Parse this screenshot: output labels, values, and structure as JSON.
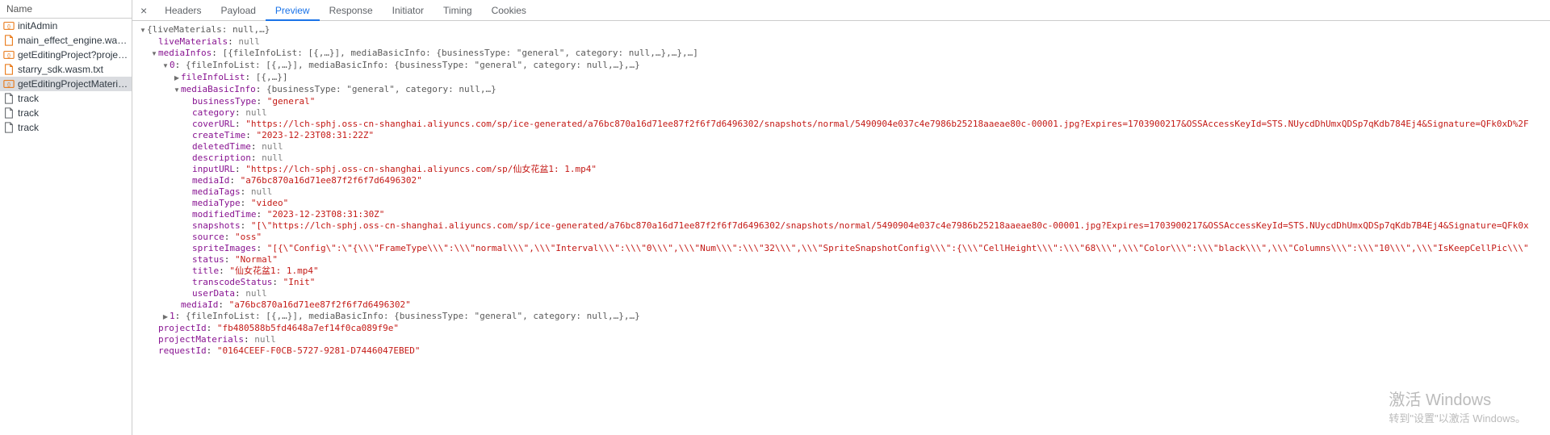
{
  "sidebar": {
    "header": "Name",
    "items": [
      {
        "icon": "xhr",
        "label": "initAdmin"
      },
      {
        "icon": "file",
        "label": "main_effect_engine.wasm.txt"
      },
      {
        "icon": "xhr",
        "label": "getEditingProject?projectId=fb..."
      },
      {
        "icon": "file",
        "label": "starry_sdk.wasm.txt"
      },
      {
        "icon": "xhr",
        "label": "getEditingProjectMaterials?pro...",
        "selected": true
      },
      {
        "icon": "doc",
        "label": "track"
      },
      {
        "icon": "doc",
        "label": "track"
      },
      {
        "icon": "doc",
        "label": "track"
      }
    ]
  },
  "tabs": {
    "close": "×",
    "items": [
      "Headers",
      "Payload",
      "Preview",
      "Response",
      "Initiator",
      "Timing",
      "Cookies"
    ],
    "active": 2
  },
  "tree": [
    {
      "d": 0,
      "t": "down",
      "raw": [
        [
          "summary",
          "{liveMaterials: null,…}"
        ]
      ]
    },
    {
      "d": 1,
      "t": "none",
      "raw": [
        [
          "key",
          "liveMaterials"
        ],
        [
          "colon",
          ": "
        ],
        [
          "null",
          "null"
        ]
      ]
    },
    {
      "d": 1,
      "t": "down",
      "raw": [
        [
          "key",
          "mediaInfos"
        ],
        [
          "colon",
          ": "
        ],
        [
          "summary",
          "[{fileInfoList: [{,…}], mediaBasicInfo: {businessType: \"general\", category: null,…},…},…]"
        ]
      ]
    },
    {
      "d": 2,
      "t": "down",
      "raw": [
        [
          "key",
          "0"
        ],
        [
          "colon",
          ": "
        ],
        [
          "summary",
          "{fileInfoList: [{,…}], mediaBasicInfo: {businessType: \"general\", category: null,…},…}"
        ]
      ]
    },
    {
      "d": 3,
      "t": "right",
      "raw": [
        [
          "key",
          "fileInfoList"
        ],
        [
          "colon",
          ": "
        ],
        [
          "summary",
          "[{,…}]"
        ]
      ]
    },
    {
      "d": 3,
      "t": "down",
      "raw": [
        [
          "key",
          "mediaBasicInfo"
        ],
        [
          "colon",
          ": "
        ],
        [
          "summary",
          "{businessType: \"general\", category: null,…}"
        ]
      ]
    },
    {
      "d": 4,
      "t": "none",
      "raw": [
        [
          "key",
          "businessType"
        ],
        [
          "colon",
          ": "
        ],
        [
          "str",
          "\"general\""
        ]
      ]
    },
    {
      "d": 4,
      "t": "none",
      "raw": [
        [
          "key",
          "category"
        ],
        [
          "colon",
          ": "
        ],
        [
          "null",
          "null"
        ]
      ]
    },
    {
      "d": 4,
      "t": "none",
      "raw": [
        [
          "key",
          "coverURL"
        ],
        [
          "colon",
          ": "
        ],
        [
          "str",
          "\"https://lch-sphj.oss-cn-shanghai.aliyuncs.com/sp/ice-generated/a76bc870a16d71ee87f2f6f7d6496302/snapshots/normal/5490904e037c4e7986b25218aaeae80c-00001.jpg?Expires=1703900217&OSSAccessKeyId=STS.NUycdDhUmxQDSp7qKdb784Ej4&Signature=QFk0xD%2F"
        ]
      ]
    },
    {
      "d": 4,
      "t": "none",
      "raw": [
        [
          "key",
          "createTime"
        ],
        [
          "colon",
          ": "
        ],
        [
          "str",
          "\"2023-12-23T08:31:22Z\""
        ]
      ]
    },
    {
      "d": 4,
      "t": "none",
      "raw": [
        [
          "key",
          "deletedTime"
        ],
        [
          "colon",
          ": "
        ],
        [
          "null",
          "null"
        ]
      ]
    },
    {
      "d": 4,
      "t": "none",
      "raw": [
        [
          "key",
          "description"
        ],
        [
          "colon",
          ": "
        ],
        [
          "null",
          "null"
        ]
      ]
    },
    {
      "d": 4,
      "t": "none",
      "raw": [
        [
          "key",
          "inputURL"
        ],
        [
          "colon",
          ": "
        ],
        [
          "str",
          "\"https://lch-sphj.oss-cn-shanghai.aliyuncs.com/sp/仙女花盆1: 1.mp4\""
        ]
      ]
    },
    {
      "d": 4,
      "t": "none",
      "raw": [
        [
          "key",
          "mediaId"
        ],
        [
          "colon",
          ": "
        ],
        [
          "str",
          "\"a76bc870a16d71ee87f2f6f7d6496302\""
        ]
      ]
    },
    {
      "d": 4,
      "t": "none",
      "raw": [
        [
          "key",
          "mediaTags"
        ],
        [
          "colon",
          ": "
        ],
        [
          "null",
          "null"
        ]
      ]
    },
    {
      "d": 4,
      "t": "none",
      "raw": [
        [
          "key",
          "mediaType"
        ],
        [
          "colon",
          ": "
        ],
        [
          "str",
          "\"video\""
        ]
      ]
    },
    {
      "d": 4,
      "t": "none",
      "raw": [
        [
          "key",
          "modifiedTime"
        ],
        [
          "colon",
          ": "
        ],
        [
          "str",
          "\"2023-12-23T08:31:30Z\""
        ]
      ]
    },
    {
      "d": 4,
      "t": "none",
      "raw": [
        [
          "key",
          "snapshots"
        ],
        [
          "colon",
          ": "
        ],
        [
          "str",
          "\"[\\\"https://lch-sphj.oss-cn-shanghai.aliyuncs.com/sp/ice-generated/a76bc870a16d71ee87f2f6f7d6496302/snapshots/normal/5490904e037c4e7986b25218aaeae80c-00001.jpg?Expires=1703900217&OSSAccessKeyId=STS.NUycdDhUmxQDSp7qKdb7B4Ej4&Signature=QFk0x"
        ]
      ]
    },
    {
      "d": 4,
      "t": "none",
      "raw": [
        [
          "key",
          "source"
        ],
        [
          "colon",
          ": "
        ],
        [
          "str",
          "\"oss\""
        ]
      ]
    },
    {
      "d": 4,
      "t": "none",
      "raw": [
        [
          "key",
          "spriteImages"
        ],
        [
          "colon",
          ": "
        ],
        [
          "str",
          "\"[{\\\"Config\\\":\\\"{\\\\\\\"FrameType\\\\\\\":\\\\\\\"normal\\\\\\\",\\\\\\\"Interval\\\\\\\":\\\\\\\"0\\\\\\\",\\\\\\\"Num\\\\\\\":\\\\\\\"32\\\\\\\",\\\\\\\"SpriteSnapshotConfig\\\\\\\":{\\\\\\\"CellHeight\\\\\\\":\\\\\\\"68\\\\\\\",\\\\\\\"Color\\\\\\\":\\\\\\\"black\\\\\\\",\\\\\\\"Columns\\\\\\\":\\\\\\\"10\\\\\\\",\\\\\\\"IsKeepCellPic\\\\\\\""
        ]
      ]
    },
    {
      "d": 4,
      "t": "none",
      "raw": [
        [
          "key",
          "status"
        ],
        [
          "colon",
          ": "
        ],
        [
          "str",
          "\"Normal\""
        ]
      ]
    },
    {
      "d": 4,
      "t": "none",
      "raw": [
        [
          "key",
          "title"
        ],
        [
          "colon",
          ": "
        ],
        [
          "str",
          "\"仙女花盆1: 1.mp4\""
        ]
      ]
    },
    {
      "d": 4,
      "t": "none",
      "raw": [
        [
          "key",
          "transcodeStatus"
        ],
        [
          "colon",
          ": "
        ],
        [
          "str",
          "\"Init\""
        ]
      ]
    },
    {
      "d": 4,
      "t": "none",
      "raw": [
        [
          "key",
          "userData"
        ],
        [
          "colon",
          ": "
        ],
        [
          "null",
          "null"
        ]
      ]
    },
    {
      "d": 3,
      "t": "none",
      "raw": [
        [
          "key",
          "mediaId"
        ],
        [
          "colon",
          ": "
        ],
        [
          "str",
          "\"a76bc870a16d71ee87f2f6f7d6496302\""
        ]
      ]
    },
    {
      "d": 2,
      "t": "right",
      "raw": [
        [
          "key",
          "1"
        ],
        [
          "colon",
          ": "
        ],
        [
          "summary",
          "{fileInfoList: [{,…}], mediaBasicInfo: {businessType: \"general\", category: null,…},…}"
        ]
      ]
    },
    {
      "d": 1,
      "t": "none",
      "raw": [
        [
          "key",
          "projectId"
        ],
        [
          "colon",
          ": "
        ],
        [
          "str",
          "\"fb480588b5fd4648a7ef14f0ca089f9e\""
        ]
      ]
    },
    {
      "d": 1,
      "t": "none",
      "raw": [
        [
          "key",
          "projectMaterials"
        ],
        [
          "colon",
          ": "
        ],
        [
          "null",
          "null"
        ]
      ]
    },
    {
      "d": 1,
      "t": "none",
      "raw": [
        [
          "key",
          "requestId"
        ],
        [
          "colon",
          ": "
        ],
        [
          "str",
          "\"0164CEEF-F0CB-5727-9281-D7446047EBED\""
        ]
      ]
    }
  ],
  "watermark": {
    "line1": "激活 Windows",
    "line2": "转到\"设置\"以激活 Windows。"
  }
}
